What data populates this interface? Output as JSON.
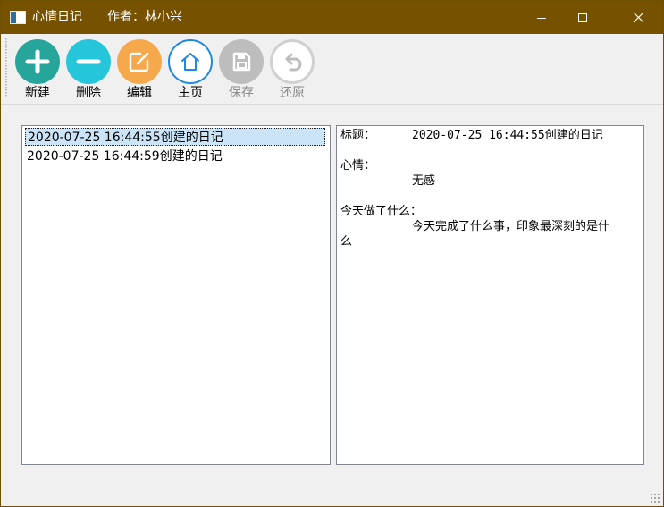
{
  "window": {
    "title": "心情日记",
    "author_text": "作者：林小兴"
  },
  "toolbar": {
    "items": [
      {
        "label": "新建",
        "icon": "plus-icon",
        "color": "#26a69a",
        "enabled": true
      },
      {
        "label": "删除",
        "icon": "minus-icon",
        "color": "#26c6da",
        "enabled": true
      },
      {
        "label": "编辑",
        "icon": "edit-icon",
        "color": "#f5a94c",
        "enabled": true
      },
      {
        "label": "主页",
        "icon": "home-icon",
        "color": "#1e88e5",
        "enabled": true
      },
      {
        "label": "保存",
        "icon": "save-icon",
        "color": "#bdbdbd",
        "enabled": false
      },
      {
        "label": "还原",
        "icon": "undo-icon",
        "color": "#bdbdbd",
        "enabled": false
      }
    ]
  },
  "diary_list": {
    "items": [
      "2020-07-25 16:44:55创建的日记",
      "2020-07-25 16:44:59创建的日记"
    ],
    "selected_index": 0
  },
  "detail": {
    "title_label": "标题：",
    "title_value": "2020-07-25 16:44:55创建的日记",
    "mood_label": "心情：",
    "mood_value": "无感",
    "today_label": "今天做了什么：",
    "today_value_line1": "今天完成了什么事，印象最深刻的是什",
    "today_value_line2": "么"
  },
  "colors": {
    "titlebar": "#765200",
    "selection": "#cce4f7"
  }
}
